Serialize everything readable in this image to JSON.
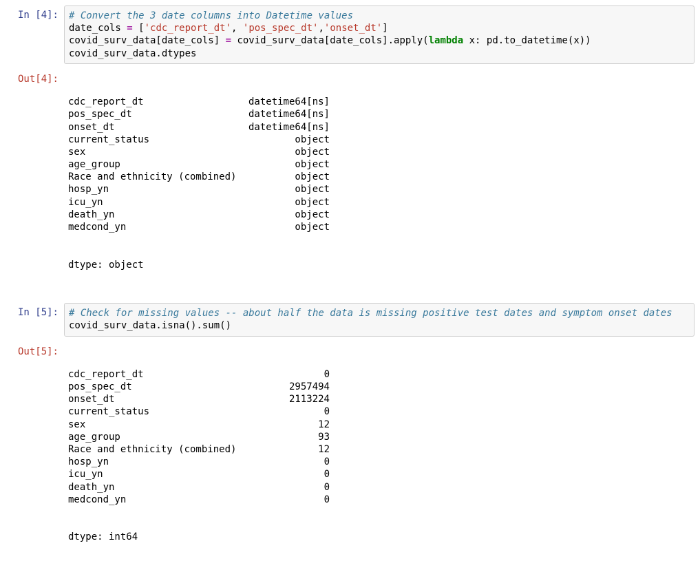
{
  "cells": {
    "cell4": {
      "in_prompt": "In [4]:",
      "out_prompt": "Out[4]:",
      "code": {
        "line1_comment": "# Convert the 3 date columns into Datetime values",
        "line2_a": "date_cols ",
        "line2_op": "=",
        "line2_b": " [",
        "line2_s1": "'cdc_report_dt'",
        "line2_c1": ", ",
        "line2_s2": "'pos_spec_dt'",
        "line2_c2": ",",
        "line2_s3": "'onset_dt'",
        "line2_d": "]",
        "line3_a": "covid_surv_data[date_cols] ",
        "line3_op": "=",
        "line3_b": " covid_surv_data[date_cols].apply(",
        "line3_kw": "lambda",
        "line3_c": " x: pd.to_datetime(x))",
        "line4": "covid_surv_data.dtypes"
      },
      "output": {
        "rows": [
          {
            "k": "cdc_report_dt",
            "v": "datetime64[ns]"
          },
          {
            "k": "pos_spec_dt",
            "v": "datetime64[ns]"
          },
          {
            "k": "onset_dt",
            "v": "datetime64[ns]"
          },
          {
            "k": "current_status",
            "v": "object"
          },
          {
            "k": "sex",
            "v": "object"
          },
          {
            "k": "age_group",
            "v": "object"
          },
          {
            "k": "Race and ethnicity (combined)",
            "v": "object"
          },
          {
            "k": "hosp_yn",
            "v": "object"
          },
          {
            "k": "icu_yn",
            "v": "object"
          },
          {
            "k": "death_yn",
            "v": "object"
          },
          {
            "k": "medcond_yn",
            "v": "object"
          }
        ],
        "footer": "dtype: object"
      }
    },
    "cell5": {
      "in_prompt": "In [5]:",
      "out_prompt": "Out[5]:",
      "code": {
        "line1_comment": "# Check for missing values -- about half the data is missing positive test dates and symptom onset dates",
        "line2": "covid_surv_data.isna().sum()"
      },
      "output": {
        "rows": [
          {
            "k": "cdc_report_dt",
            "v": "0"
          },
          {
            "k": "pos_spec_dt",
            "v": "2957494"
          },
          {
            "k": "onset_dt",
            "v": "2113224"
          },
          {
            "k": "current_status",
            "v": "0"
          },
          {
            "k": "sex",
            "v": "12"
          },
          {
            "k": "age_group",
            "v": "93"
          },
          {
            "k": "Race and ethnicity (combined)",
            "v": "12"
          },
          {
            "k": "hosp_yn",
            "v": "0"
          },
          {
            "k": "icu_yn",
            "v": "0"
          },
          {
            "k": "death_yn",
            "v": "0"
          },
          {
            "k": "medcond_yn",
            "v": "0"
          }
        ],
        "footer": "dtype: int64"
      }
    }
  }
}
